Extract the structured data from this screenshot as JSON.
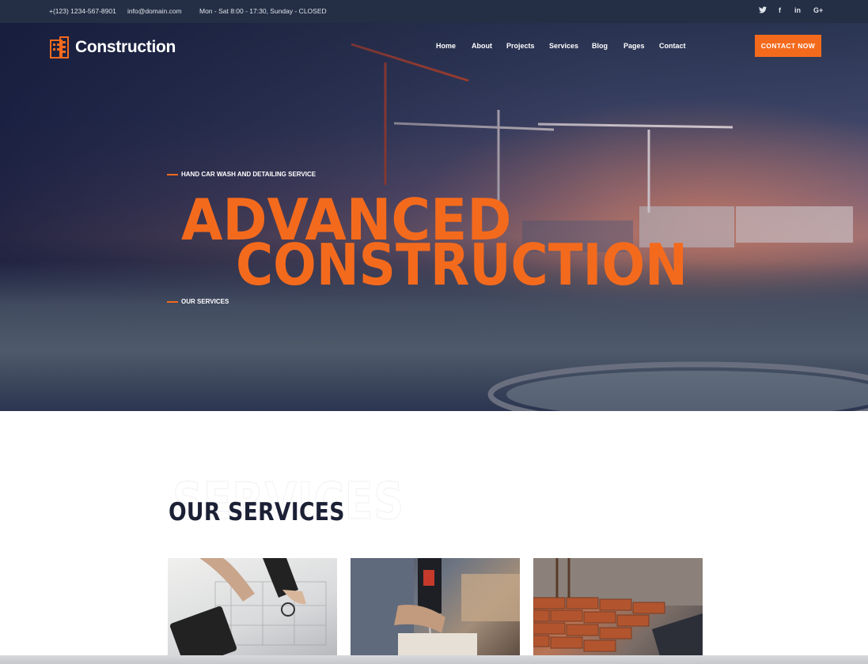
{
  "topbar": {
    "phone": "+(123) 1234-567-8901",
    "email": "info@domain.com",
    "hours": "Mon - Sat 8:00 - 17:30, Sunday - CLOSED",
    "social": [
      "twitter-icon",
      "facebook-icon",
      "linkedin-icon",
      "google-plus-icon"
    ],
    "social_glyphs": {
      "twitter": "🐦",
      "facebook": "f",
      "linkedin": "in",
      "google_plus": "G+"
    }
  },
  "header": {
    "brand": "Construction",
    "nav": [
      "Home",
      "About",
      "Projects",
      "Services",
      "Blog",
      "Pages",
      "Contact"
    ],
    "cta": "CONTACT NOW"
  },
  "hero": {
    "tagline": "HAND CAR WASH AND DETAILING SERVICE",
    "headline_line1": "ADVANCED",
    "headline_line2": "CONSTRUCTION",
    "link": "OUR SERVICES"
  },
  "services": {
    "ghost_text": "SERVICES",
    "title": "OUR SERVICES",
    "cards": [
      "planning-image",
      "drilling-image",
      "bricklaying-image"
    ]
  },
  "colors": {
    "accent": "#f46a1d",
    "topbar": "#242f45",
    "title_dark": "#1b2035"
  }
}
